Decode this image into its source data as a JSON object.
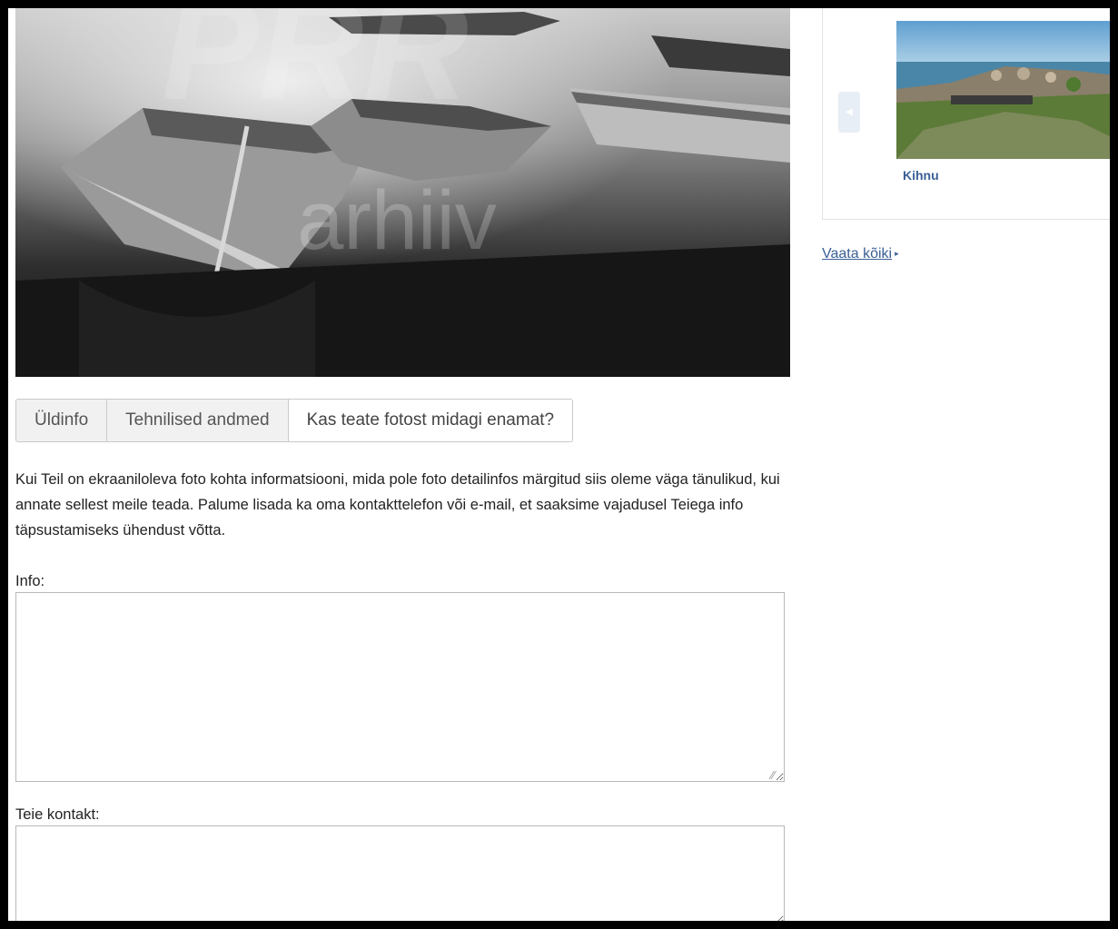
{
  "photo": {
    "watermark": "arhiiv"
  },
  "tabs": [
    {
      "label": "Üldinfo"
    },
    {
      "label": "Tehnilised andmed"
    },
    {
      "label": "Kas teate fotost midagi enamat?"
    }
  ],
  "form": {
    "intro": "Kui Teil on ekraaniloleva foto kohta informatsiooni, mida pole foto detailinfos märgitud siis oleme väga tänulikud, kui annate sellest meile teada.   Palume lisada ka oma kontakttelefon või e-mail, et saaksime vajadusel Teiega info täpsustamiseks ühendust võtta.",
    "info_label": "Info:",
    "info_value": "",
    "contact_label": "Teie kontakt:",
    "contact_value": ""
  },
  "sidebar": {
    "thumbnail_caption": "Kihnu",
    "see_all_label": "Vaata kõiki",
    "prev_icon": "chevron-left-icon",
    "link_color": "#3a5f95"
  }
}
